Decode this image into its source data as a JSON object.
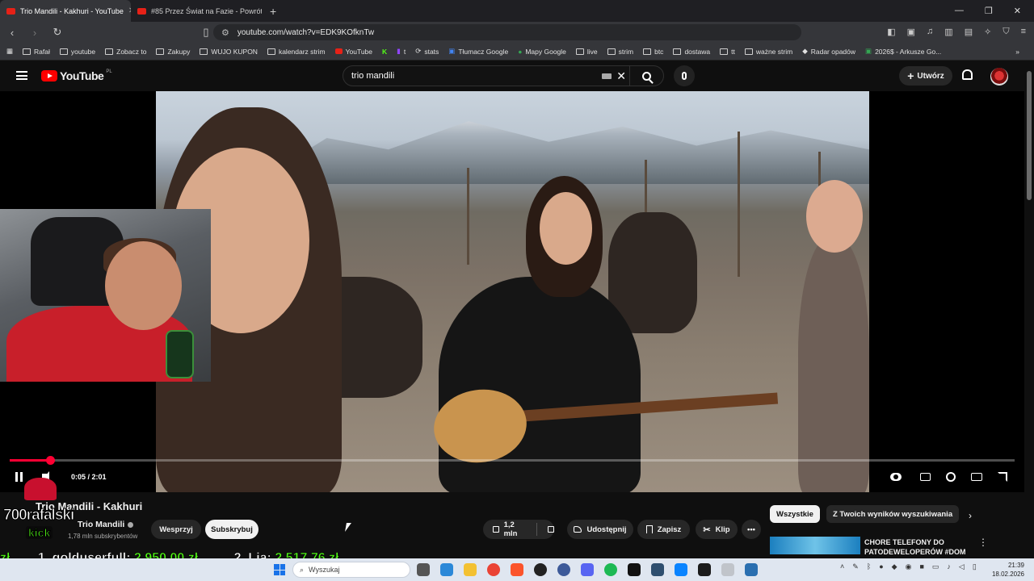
{
  "browser": {
    "tabs": [
      {
        "label": "Trio Mandili - Kakhuri - YouTube",
        "active": true
      },
      {
        "label": "#85 Przez Świat na Fazie - Powrót do…",
        "active": false
      }
    ],
    "url": "youtube.com/watch?v=EDK9KOfknTw",
    "bookmarks": [
      "Rafał",
      "youtube",
      "Zobacz to",
      "Zakupy",
      "WUJO KUPON",
      "kalendarz strim",
      "YouTube",
      "t",
      "stats",
      "Tłumacz Google",
      "Mapy Google",
      "live",
      "strim",
      "btc",
      "dostawa",
      "tt",
      "ważne strim",
      "Radar opadów",
      "2026$ - Arkusze Go..."
    ]
  },
  "youtube": {
    "logo_text": "YouTube",
    "region": "PL",
    "search_value": "trio mandili",
    "create_label": "Utwórz"
  },
  "player": {
    "time": "0:05 / 2:01",
    "progress_fraction": 0.04
  },
  "video": {
    "title": "Trio Mandili - Kakhuri",
    "channel": "Trio Mandili",
    "subscribers": "1,78 mln subskrybentów",
    "support_label": "Wesprzyj",
    "subscribe_label": "Subskrybuj",
    "likes": "1,2 mln",
    "share_label": "Udostępnij",
    "save_label": "Zapisz",
    "clip_label": "Klip"
  },
  "sidebar": {
    "chips": [
      "Wszystkie",
      "Z Twoich wyników wyszukiwania"
    ],
    "rec_title_1": "CHORE TELEFONY DO",
    "rec_title_2": "PATODEWELOPERÓW #DOM"
  },
  "overlay": {
    "streamer": "700rafalski",
    "platform": "kick",
    "ticker_1_name": "1. golduserfull:",
    "ticker_1_amount": "2 950,00 zł",
    "ticker_2_name": "2. Lia:",
    "ticker_2_amount": "2 517,76 zł"
  },
  "taskbar": {
    "search_placeholder": "Wyszukaj",
    "time": "21:39",
    "date": "18.02.2026"
  },
  "colors": {
    "youtube_red": "#ff0000",
    "kick_green": "#53fc18"
  }
}
